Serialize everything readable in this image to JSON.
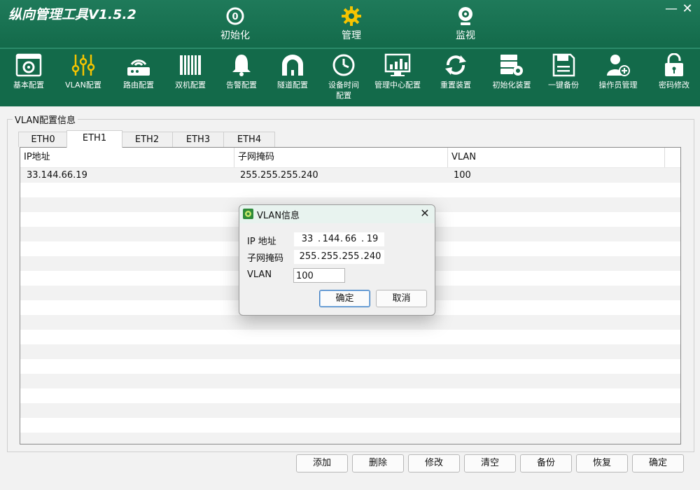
{
  "app": {
    "title": "纵向管理工具V1.5.2",
    "minimize": "—",
    "close": "✕"
  },
  "main_tabs": [
    {
      "label": "初始化",
      "icon": "init-icon"
    },
    {
      "label": "管理",
      "icon": "gear-icon"
    },
    {
      "label": "监视",
      "icon": "camera-icon"
    }
  ],
  "toolbar": [
    {
      "label": "基本配置",
      "icon": "basic-config-icon"
    },
    {
      "label": "VLAN配置",
      "icon": "sliders-icon"
    },
    {
      "label": "路由配置",
      "icon": "router-icon"
    },
    {
      "label": "双机配置",
      "icon": "dual-machine-icon"
    },
    {
      "label": "告警配置",
      "icon": "bell-icon"
    },
    {
      "label": "隧道配置",
      "icon": "tunnel-icon"
    },
    {
      "label": "设备时间配置",
      "line1": "设备时间",
      "line2": "配置",
      "icon": "clock-icon"
    },
    {
      "label": "管理中心配置",
      "icon": "monitor-chart-icon"
    },
    {
      "label": "重置装置",
      "icon": "refresh-icon"
    },
    {
      "label": "初始化装置",
      "icon": "server-gear-icon"
    },
    {
      "label": "一键备份",
      "icon": "save-icon"
    },
    {
      "label": "操作员管理",
      "icon": "user-add-icon"
    },
    {
      "label": "密码修改",
      "icon": "lock-icon"
    }
  ],
  "group_title": "VLAN配置信息",
  "eth_tabs": [
    "ETH0",
    "ETH1",
    "ETH2",
    "ETH3",
    "ETH4"
  ],
  "active_tab": "ETH1",
  "table": {
    "columns": [
      "IP地址",
      "子网掩码",
      "VLAN"
    ],
    "rows": [
      {
        "ip": "33.144.66.19",
        "mask": "255.255.255.240",
        "vlan": "100"
      }
    ]
  },
  "buttons": [
    "添加",
    "删除",
    "修改",
    "清空",
    "备份",
    "恢复",
    "确定"
  ],
  "dialog": {
    "title": "VLAN信息",
    "ip_label": "IP 地址",
    "mask_label": "子网掩码",
    "vlan_label": "VLAN",
    "ip": [
      "33",
      "144",
      "66",
      "19"
    ],
    "mask": [
      "255",
      "255",
      "255",
      "240"
    ],
    "vlan_value": "100",
    "ok": "确定",
    "cancel": "取消",
    "close": "✕"
  }
}
